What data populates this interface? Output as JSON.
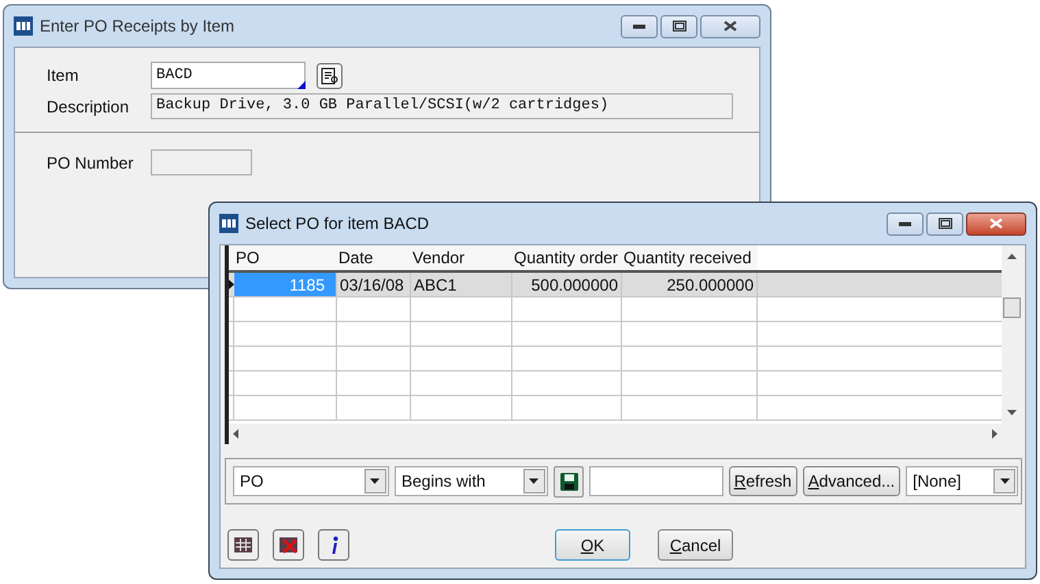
{
  "main_window": {
    "title": "Enter PO Receipts by Item",
    "item": {
      "label": "Item",
      "value": "BACD"
    },
    "description": {
      "label": "Description",
      "value": "Backup Drive, 3.0 GB Parallel/SCSI(w/2 cartridges)"
    },
    "po_number": {
      "label": "PO Number"
    }
  },
  "dialog": {
    "title": "Select PO for item BACD",
    "columns": [
      "PO",
      "Date",
      "Vendor",
      "Quantity order",
      "Quantity received"
    ],
    "rows": [
      {
        "selected": true,
        "cells": [
          "1185",
          "03/16/08",
          "ABC1",
          "500.000000",
          "250.000000"
        ]
      }
    ],
    "filter": {
      "field": "PO",
      "operator": "Begins with",
      "layout": "[None]"
    },
    "buttons": [
      {
        "label": "Refresh",
        "mnemonic": true,
        "default": false
      },
      {
        "label": "Advanced...",
        "mnemonic": true,
        "default": false
      }
    ],
    "footer_buttons": [
      {
        "label": "OK",
        "mnemonic": true,
        "default": true
      },
      {
        "label": "Cancel",
        "mnemonic": true,
        "default": false
      }
    ]
  }
}
